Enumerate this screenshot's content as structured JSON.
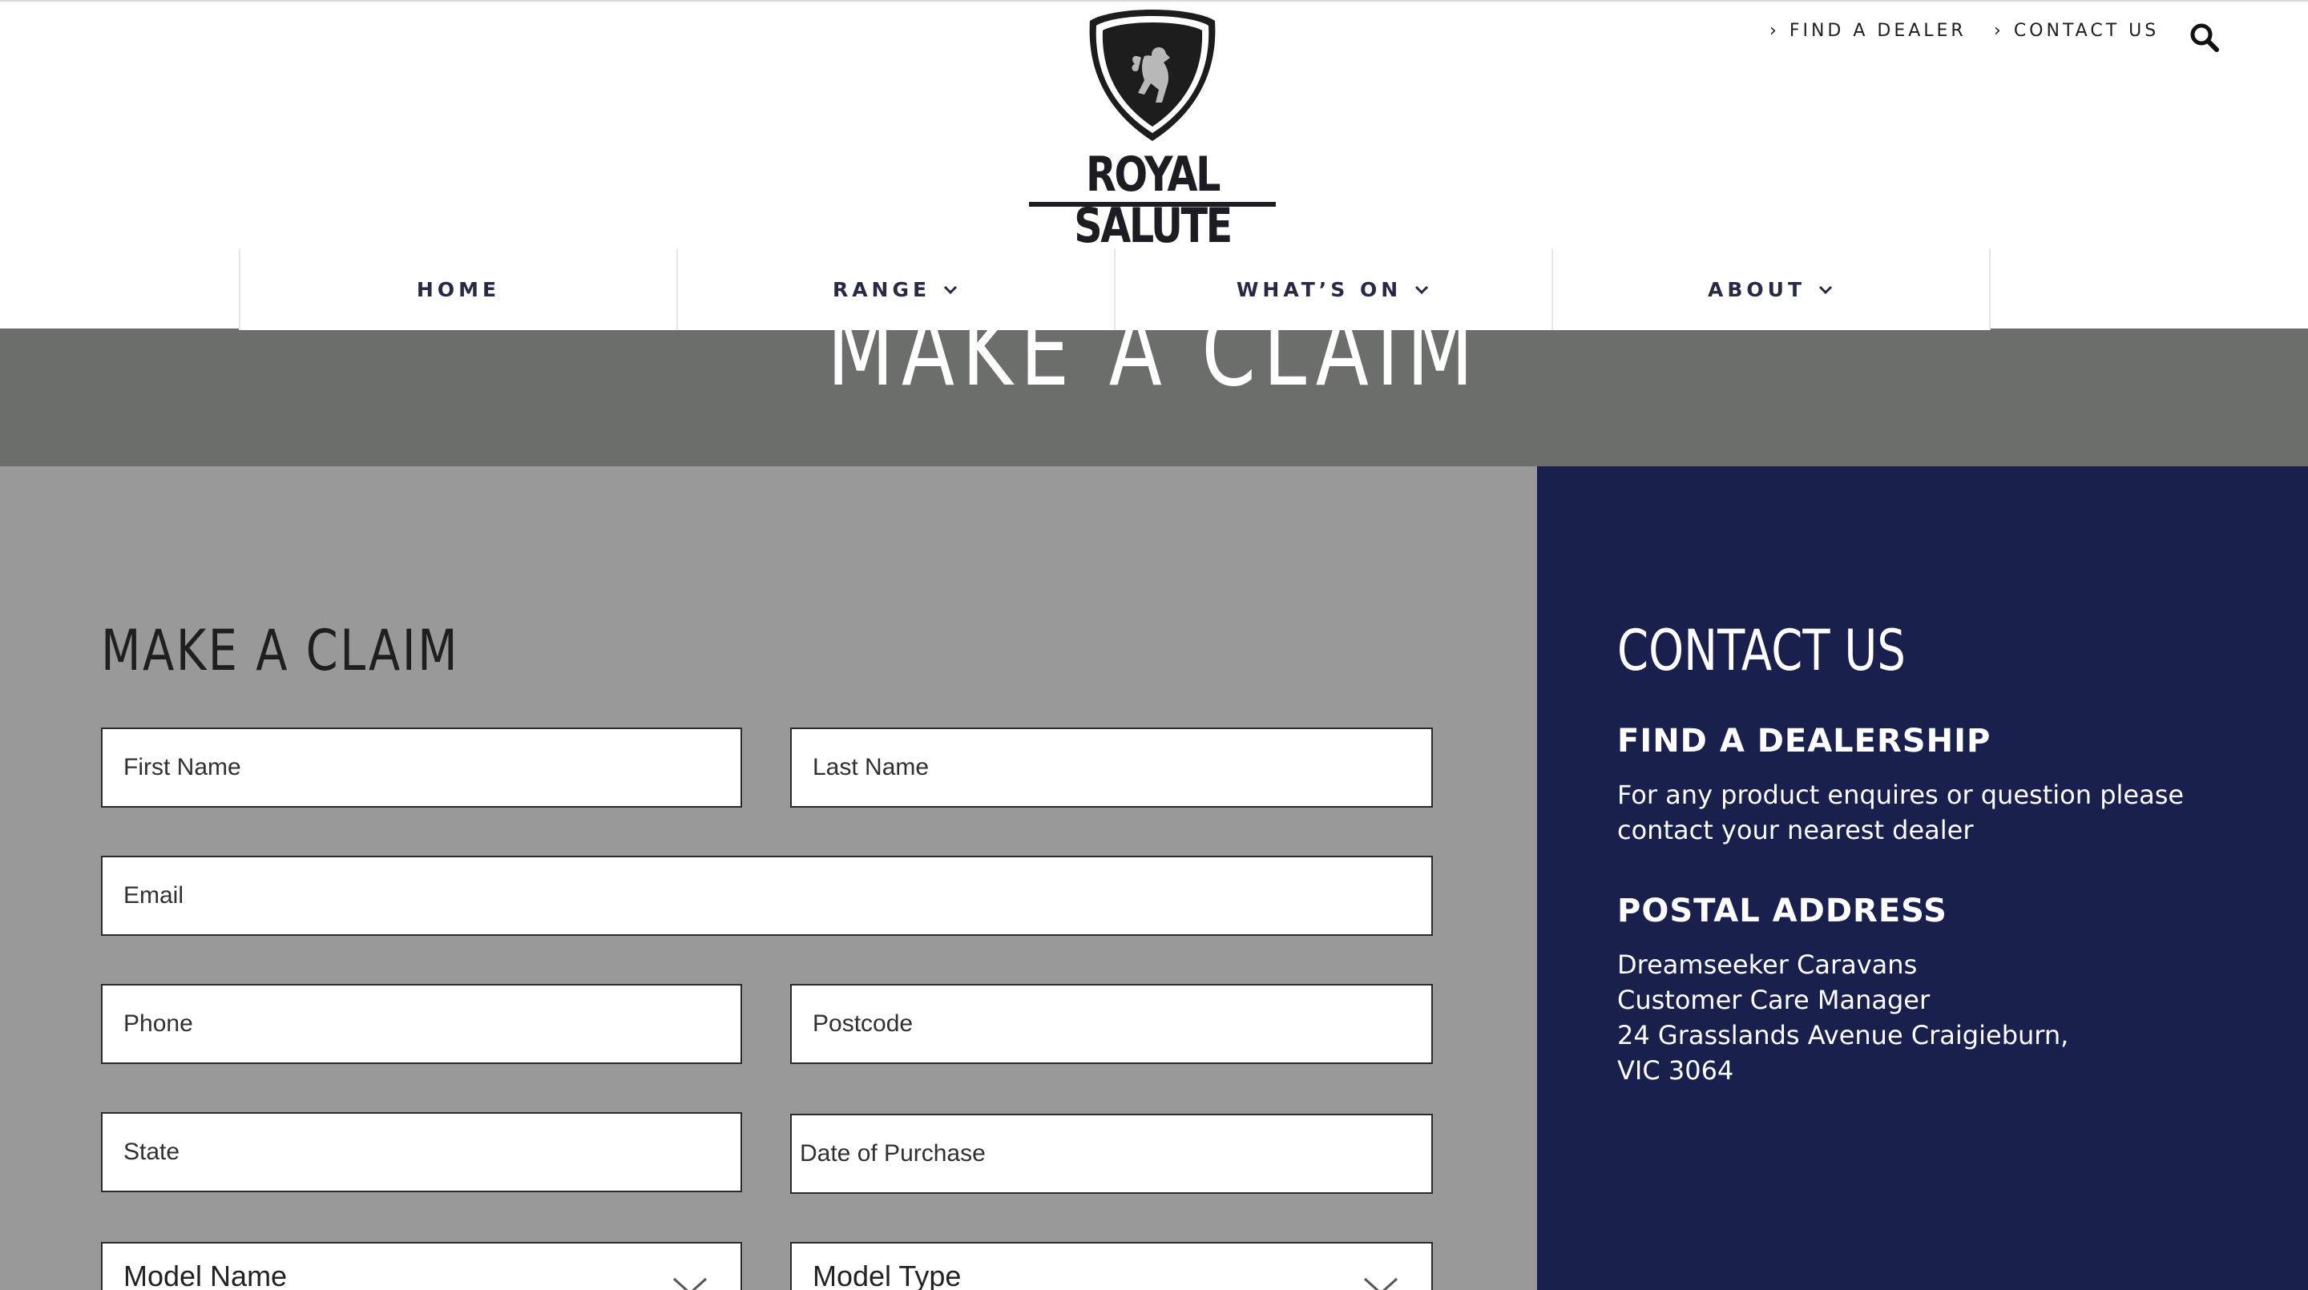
{
  "header": {
    "brand": "ROYAL SALUTE",
    "top_links": [
      {
        "label": "FIND A DEALER"
      },
      {
        "label": "CONTACT US"
      }
    ],
    "search_icon": "search-icon",
    "nav": [
      {
        "label": "HOME",
        "has_dropdown": false
      },
      {
        "label": "RANGE",
        "has_dropdown": true
      },
      {
        "label": "WHAT’S ON",
        "has_dropdown": true
      },
      {
        "label": "ABOUT",
        "has_dropdown": true
      }
    ]
  },
  "hero": {
    "title": "MAKE A CLAIM",
    "background": "#6b6e6b"
  },
  "form": {
    "title": "MAKE A CLAIM",
    "fields": {
      "first_name": {
        "placeholder": "First Name",
        "value": ""
      },
      "last_name": {
        "placeholder": "Last Name",
        "value": ""
      },
      "email": {
        "placeholder": "Email",
        "value": ""
      },
      "phone": {
        "placeholder": "Phone",
        "value": ""
      },
      "postcode": {
        "placeholder": "Postcode",
        "value": ""
      },
      "state": {
        "placeholder": "State",
        "value": ""
      },
      "date_of_purchase": {
        "placeholder": "Date of Purchase",
        "value": ""
      }
    },
    "selects": {
      "model_name": {
        "selected": "Model Name"
      },
      "model_type": {
        "selected": "Model Type"
      }
    },
    "background": "#999999"
  },
  "contact": {
    "title": "CONTACT US",
    "dealership": {
      "heading": "FIND A DEALERSHIP",
      "lines": [
        "For any product enquires or question please",
        "contact your nearest dealer"
      ]
    },
    "postal": {
      "heading": "POSTAL ADDRESS",
      "lines": [
        "Dreamseeker Caravans",
        "Customer Care Manager",
        "24 Grasslands Avenue Craigieburn,",
        "VIC 3064"
      ]
    },
    "background": "#19204d"
  }
}
